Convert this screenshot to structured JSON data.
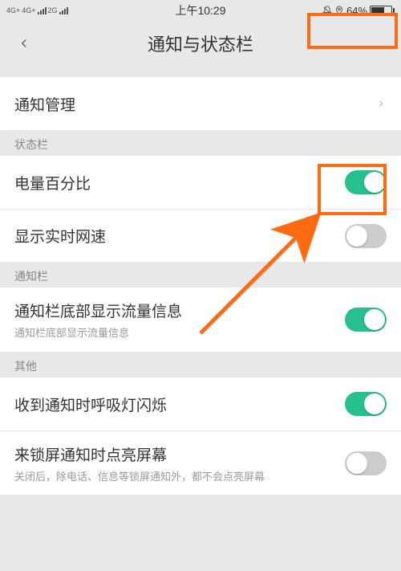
{
  "status": {
    "network1": "4G+",
    "network2": "4G+",
    "network3": "2G",
    "time": "上午10:29",
    "battery_pct": "64%"
  },
  "nav": {
    "title": "通知与状态栏"
  },
  "sections": {
    "mgmt": {
      "title": "通知管理"
    },
    "statusbar_header": "状态栏",
    "battery_pct": {
      "title": "电量百分比",
      "on": true
    },
    "net_speed": {
      "title": "显示实时网速",
      "on": false
    },
    "notibar_header": "通知栏",
    "traffic": {
      "title": "通知栏底部显示流量信息",
      "sub": "通知栏底部显示流量信息",
      "on": true
    },
    "other_header": "其他",
    "led": {
      "title": "收到通知时呼吸灯闪烁",
      "on": true
    },
    "wake": {
      "title": "来锁屏通知时点亮屏幕",
      "sub": "关闭后，除电话、信息等锁屏通知外，都不会点亮屏幕",
      "on": false
    }
  }
}
